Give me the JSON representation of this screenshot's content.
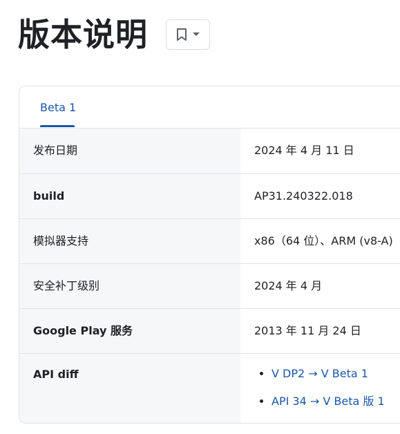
{
  "page": {
    "title": "版本说明"
  },
  "bookmark": {
    "icon": "bookmark-icon",
    "dropdown_icon": "caret-down-icon"
  },
  "tabs": [
    {
      "label": "Beta 1",
      "active": true
    }
  ],
  "rows": [
    {
      "key": "发布日期",
      "value": "2024 年 4 月 11 日"
    },
    {
      "key": "build",
      "value": "AP31.240322.018"
    },
    {
      "key": "模拟器支持",
      "value": "x86（64 位）、ARM (v8-A)"
    },
    {
      "key": "安全补丁级别",
      "value": "2024 年 4 月"
    },
    {
      "key": "Google Play 服务",
      "value": "2013 年 11 月 24 日"
    },
    {
      "key": "API diff",
      "links": [
        "V DP2 → V Beta 1",
        "API 34 → V Beta 版 1"
      ]
    }
  ],
  "colors": {
    "accent": "#1a56a8",
    "key_background": "#f6f7f9",
    "border": "#e3e3e3"
  }
}
